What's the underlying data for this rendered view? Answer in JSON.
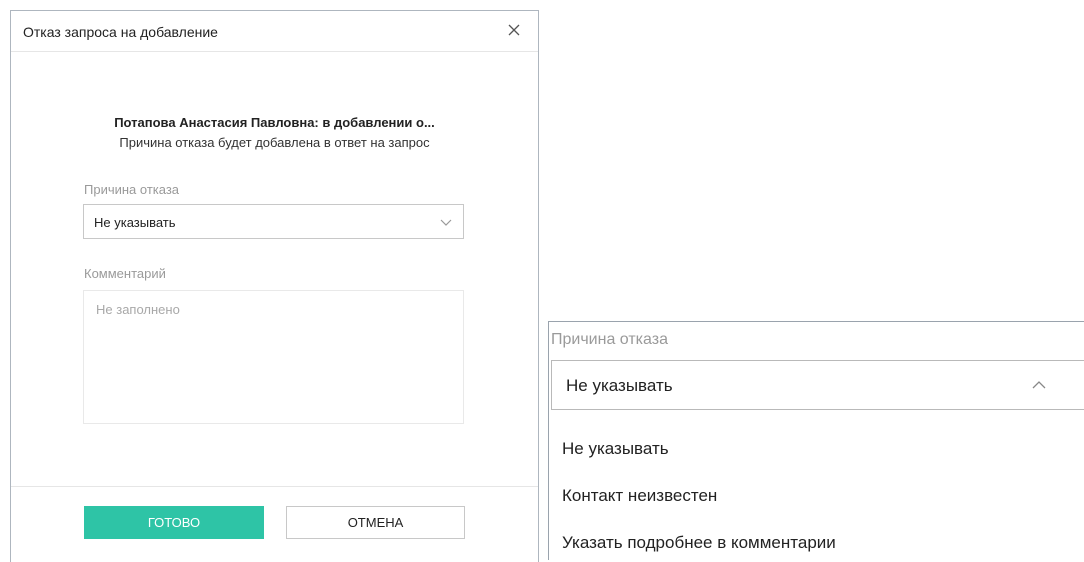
{
  "dialog": {
    "title": "Отказ запроса на добавление",
    "close_icon": "close-icon",
    "headline": "Потапова Анастасия Павловна: в добавлении о...",
    "subtitle": "Причина отказа будет добавлена в ответ на запрос",
    "reason": {
      "label": "Причина отказа",
      "value": "Не указывать",
      "chevron_icon": "chevron-down-icon"
    },
    "comment": {
      "label": "Комментарий",
      "placeholder": "Не заполнено"
    },
    "buttons": {
      "done": "ГОТОВО",
      "cancel": "ОТМЕНА"
    },
    "colors": {
      "primary": "#2ec4a6"
    }
  },
  "dropdown_detail": {
    "label": "Причина отказа",
    "value": "Не указывать",
    "chevron_icon": "chevron-up-icon",
    "options": [
      "Не указывать",
      "Контакт неизвестен",
      "Указать подробнее в комментарии"
    ]
  }
}
